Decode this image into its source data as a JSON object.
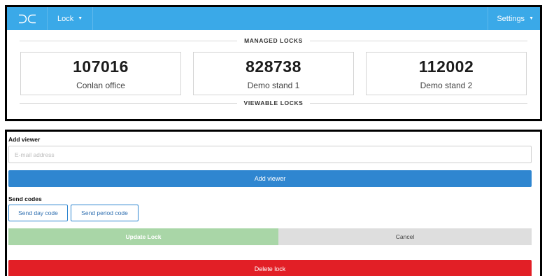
{
  "navbar": {
    "logo_icon": "dc-logo-icon",
    "lock_menu_label": "Lock",
    "settings_label": "Settings",
    "accent_color": "#3aa9e8"
  },
  "managed": {
    "heading": "MANAGED LOCKS",
    "locks": [
      {
        "code": "107016",
        "name": "Conlan office"
      },
      {
        "code": "828738",
        "name": "Demo stand 1"
      },
      {
        "code": "112002",
        "name": "Demo stand 2"
      }
    ]
  },
  "viewable": {
    "heading": "VIEWABLE LOCKS"
  },
  "form": {
    "add_viewer_label": "Add viewer",
    "email_placeholder": "E-mail address",
    "add_viewer_button": "Add viewer",
    "send_codes_label": "Send codes",
    "send_day_code_button": "Send day code",
    "send_period_code_button": "Send period code",
    "update_lock_button": "Update Lock",
    "cancel_button": "Cancel",
    "delete_lock_button": "Delete lock"
  },
  "colors": {
    "primary": "#2f86d0",
    "success_disabled": "#a9d6a7",
    "danger": "#e21f26",
    "neutral": "#dedede"
  }
}
